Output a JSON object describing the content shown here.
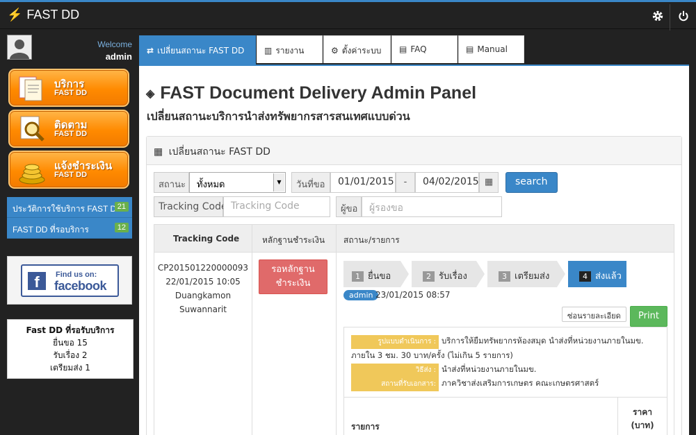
{
  "topbar": {
    "brand": "FAST DD"
  },
  "sidebar": {
    "welcome": "Welcome",
    "user": "admin",
    "buttons": [
      {
        "title": "บริการ",
        "sub": "FAST DD"
      },
      {
        "title": "ติดตาม",
        "sub": "FAST DD"
      },
      {
        "title": "แจ้งชำระเงิน",
        "sub": "FAST DD"
      }
    ],
    "links": [
      {
        "label": "ประวัติการใช้บริการ FAST DD",
        "count": "21"
      },
      {
        "label": "FAST DD ที่รอบริการ",
        "count": "12"
      }
    ],
    "facebook": {
      "find": "Find us on:",
      "word": "facebook"
    },
    "waiting": {
      "title": "Fast DD ที่รอรับบริการ",
      "lines": [
        "ยื่นขอ 15",
        "รับเรื่อง 2",
        "เตรียมส่ง 1"
      ]
    }
  },
  "tabs": [
    {
      "label": "เปลี่ยนสถานะ FAST DD",
      "icon": "⇄"
    },
    {
      "label": "รายงาน",
      "icon": "▥"
    },
    {
      "label": "ตั้งค่าระบบ",
      "icon": "⚙"
    },
    {
      "label": "FAQ",
      "icon": "▤"
    },
    {
      "label": "Manual",
      "icon": "▤"
    }
  ],
  "page": {
    "title": "FAST Document Delivery Admin Panel",
    "subtitle": "เปลี่ยนสถานะบริการนำส่งทรัพยากรสารสนเทศแบบด่วน",
    "panel_title": "เปลี่ยนสถานะ FAST DD"
  },
  "filters": {
    "status_label": "สถานะ",
    "status_value": "ทั้งหมด",
    "date_label": "วันที่ขอ",
    "date_from": "01/01/2015",
    "date_sep": "-",
    "date_to": "04/02/2015",
    "search": "search",
    "tracking_label": "Tracking Code",
    "tracking_placeholder": "Tracking Code",
    "requester_label": "ผู้ขอ",
    "requester_placeholder": "ผู้รองขอ"
  },
  "table": {
    "headers": [
      "Tracking Code",
      "หลักฐานชำระเงิน",
      "สถานะ/รายการ"
    ],
    "row": {
      "code": "CP201501220000093",
      "date": "22/01/2015 10:05",
      "name1": "Duangkamon",
      "name2": "Suwannarit",
      "payment_line1": "รอหลักฐาน",
      "payment_line2": "ชำระเงิน",
      "steps": [
        {
          "num": "1",
          "label": "ยื่นขอ"
        },
        {
          "num": "2",
          "label": "รับเรื่อง"
        },
        {
          "num": "3",
          "label": "เตรียมส่ง"
        },
        {
          "num": "4",
          "label": "ส่งแล้ว"
        }
      ],
      "by": "admin",
      "by_date": "23/01/2015 08:57",
      "hide_btn": "ซ่อนรายละเอียด",
      "print_btn": "Print",
      "details": [
        {
          "key": "รูปแบบดำเนินการ :",
          "value": "บริการให้ยืมทรัพยากรห้องสมุด นำส่งที่หน่วยงานภายในมข. ภายใน 3 ชม. 30 บาท/ครั้ง (ไม่เกิน 5 รายการ)"
        },
        {
          "key": "วิธีส่ง :",
          "value": "นำส่งที่หน่วยงานภายในมข."
        },
        {
          "key": "สถานที่รับเอกสาร:",
          "value": "ภาควิชาส่งเสริมการเกษตร คณะเกษตรศาสตร์"
        }
      ],
      "items_col": "รายการ",
      "price_col1": "ราคา",
      "price_col2": "(บาท)"
    }
  },
  "colors": {
    "accent": "#3a87c8",
    "orange": "#ff8a00",
    "success": "#5cb85c",
    "danger": "#d9534f"
  }
}
